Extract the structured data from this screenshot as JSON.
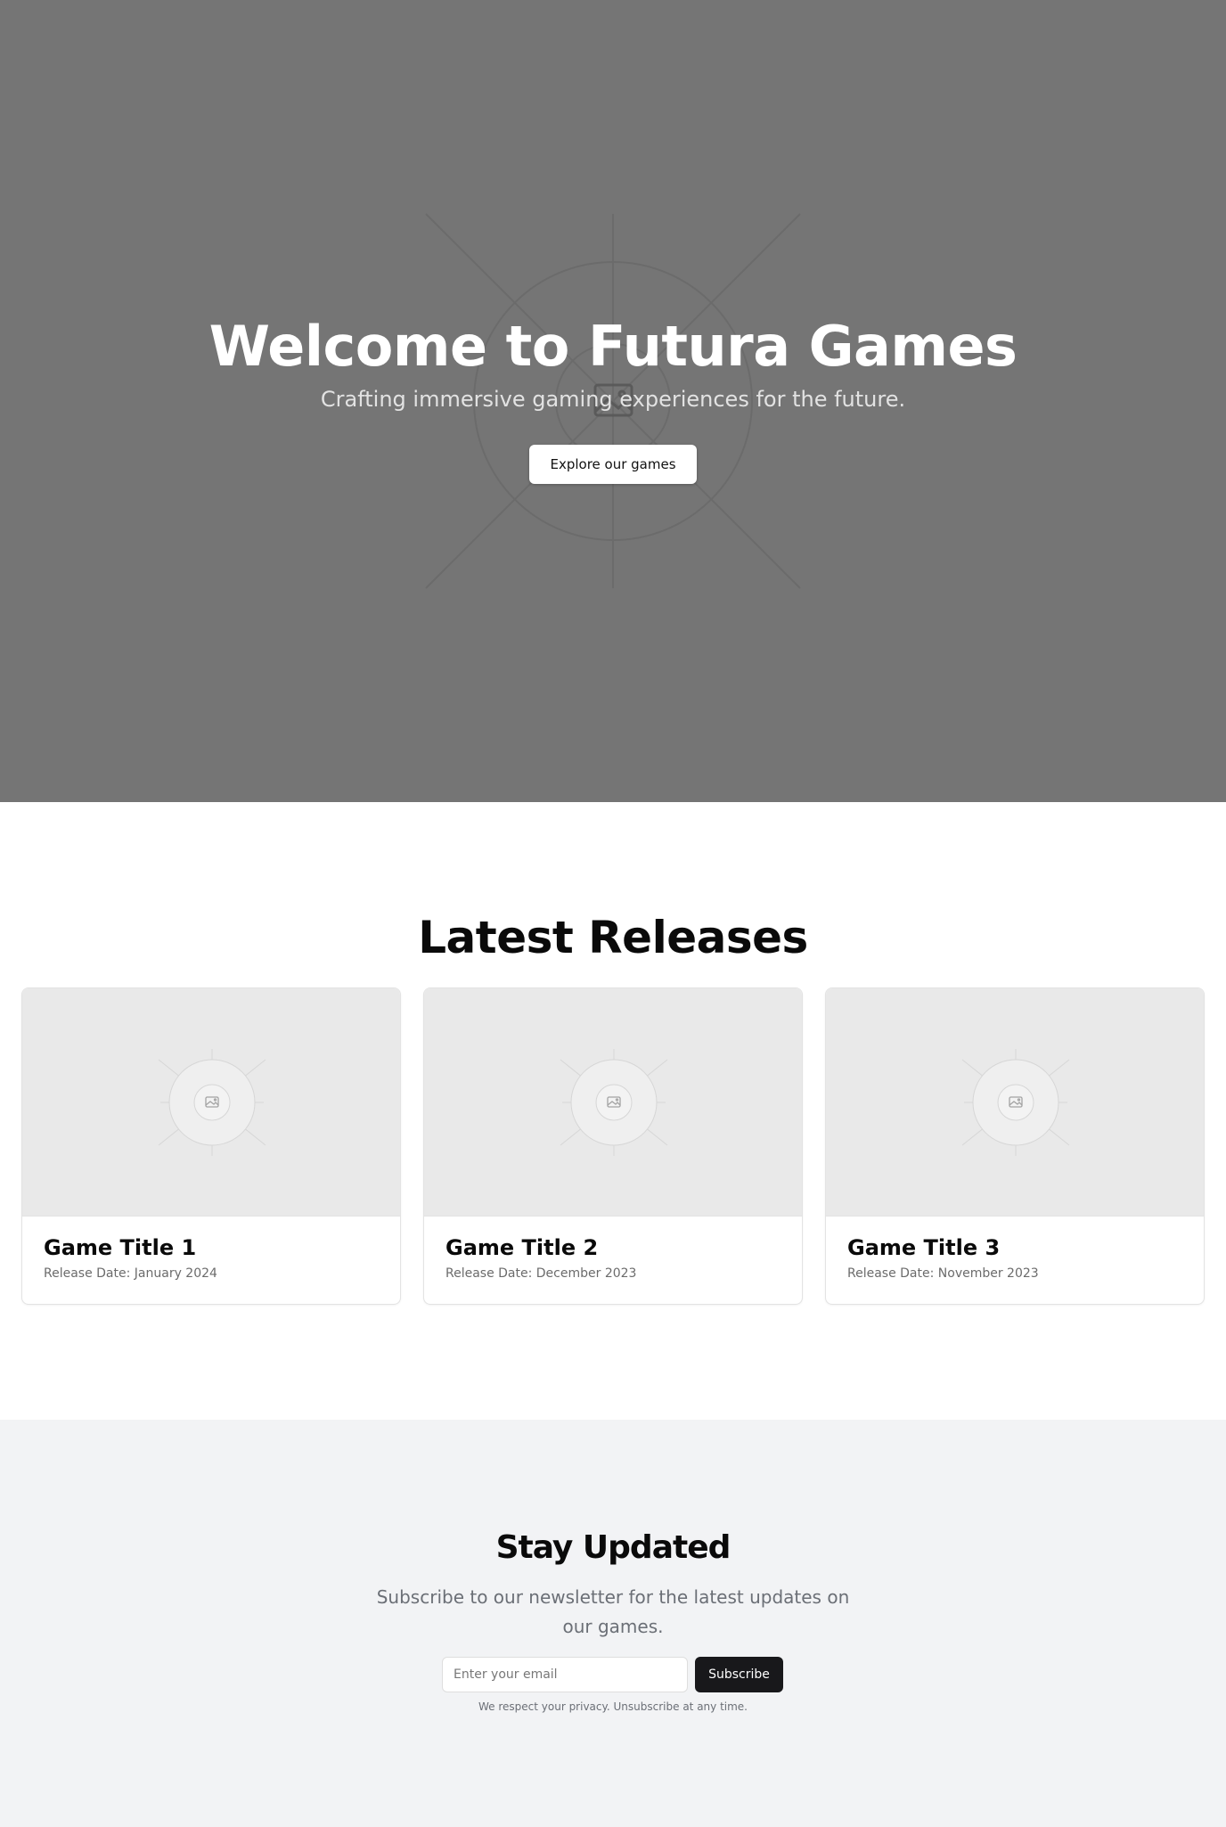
{
  "hero": {
    "title": "Welcome to Futura Games",
    "subtitle": "Crafting immersive gaming experiences for the future.",
    "cta_label": "Explore our games",
    "image_icon": "image-placeholder-icon"
  },
  "releases": {
    "title": "Latest Releases",
    "games": [
      {
        "title": "Game Title 1",
        "release_date": "Release Date: January 2024",
        "image_icon": "image-placeholder-icon"
      },
      {
        "title": "Game Title 2",
        "release_date": "Release Date: December 2023",
        "image_icon": "image-placeholder-icon"
      },
      {
        "title": "Game Title 3",
        "release_date": "Release Date: November 2023",
        "image_icon": "image-placeholder-icon"
      }
    ]
  },
  "newsletter": {
    "title": "Stay Updated",
    "subtitle": "Subscribe to our newsletter for the latest updates on our games.",
    "email_placeholder": "Enter your email",
    "email_value": "",
    "subscribe_label": "Subscribe",
    "privacy_note": "We respect your privacy. Unsubscribe at any time."
  },
  "colors": {
    "hero_background": "#757575",
    "card_image_background": "#e9e9e9",
    "newsletter_background": "#f2f3f5",
    "primary_button": "#18181b"
  }
}
